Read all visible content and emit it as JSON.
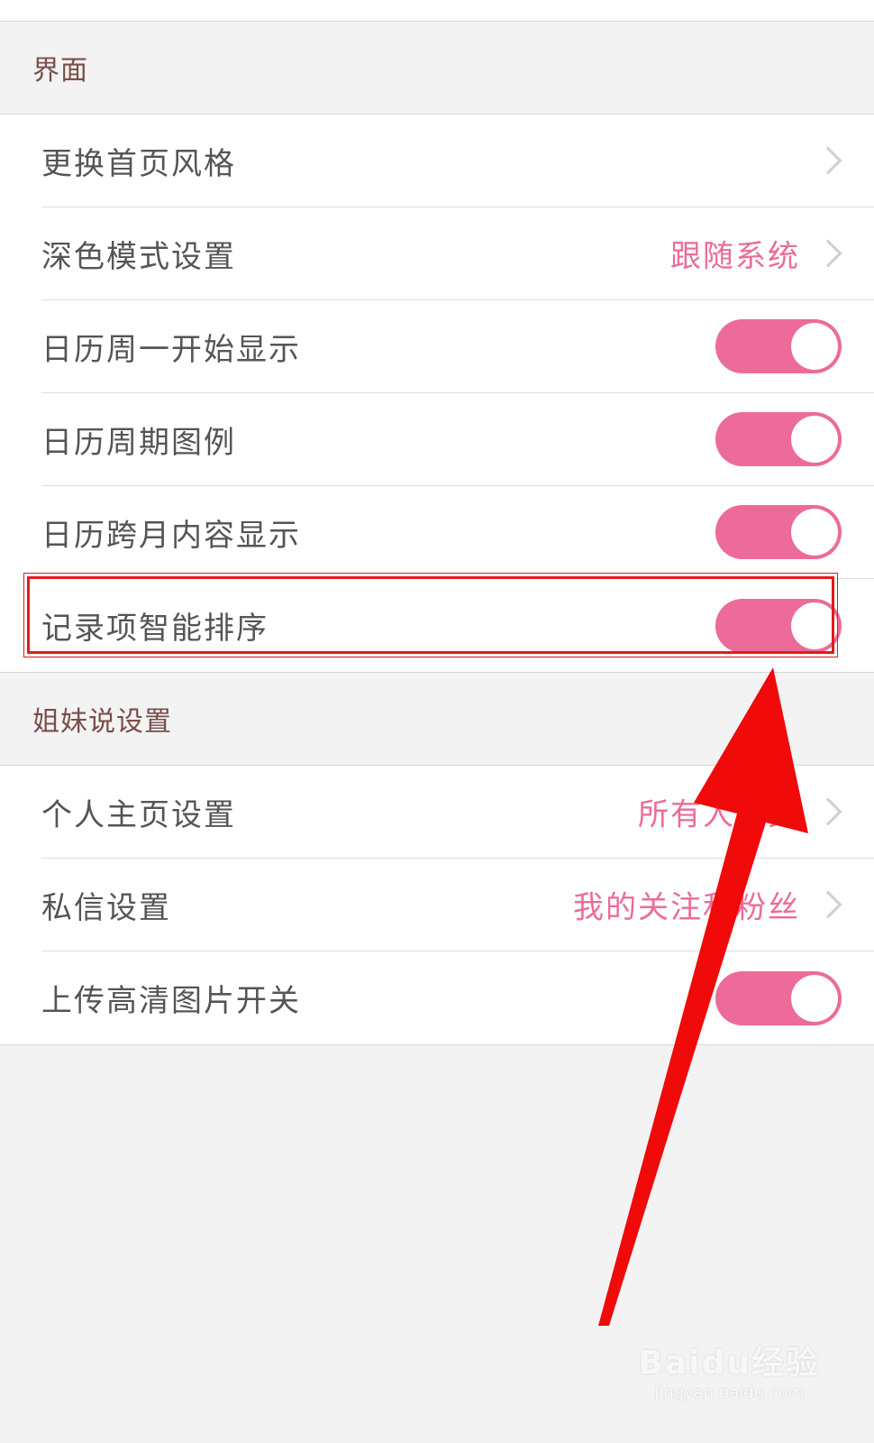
{
  "sections": [
    {
      "title": "界面",
      "rows": [
        {
          "label": "更换首页风格",
          "type": "link"
        },
        {
          "label": "深色模式设置",
          "type": "link",
          "value": "跟随系统"
        },
        {
          "label": "日历周一开始显示",
          "type": "toggle",
          "on": true
        },
        {
          "label": "日历周期图例",
          "type": "toggle",
          "on": true
        },
        {
          "label": "日历跨月内容显示",
          "type": "toggle",
          "on": true
        },
        {
          "label": "记录项智能排序",
          "type": "toggle",
          "on": true
        }
      ]
    },
    {
      "title": "姐妹说设置",
      "rows": [
        {
          "label": "个人主页设置",
          "type": "link",
          "value": "所有人可见"
        },
        {
          "label": "私信设置",
          "type": "link",
          "value": "我的关注和粉丝"
        },
        {
          "label": "上传高清图片开关",
          "type": "toggle",
          "on": true
        }
      ]
    }
  ],
  "colors": {
    "accent": "#ec6b9a",
    "annotation": "#e21b1b"
  },
  "watermark": {
    "logo": "Baidu经验",
    "url": "jingyan.baidu.com"
  }
}
